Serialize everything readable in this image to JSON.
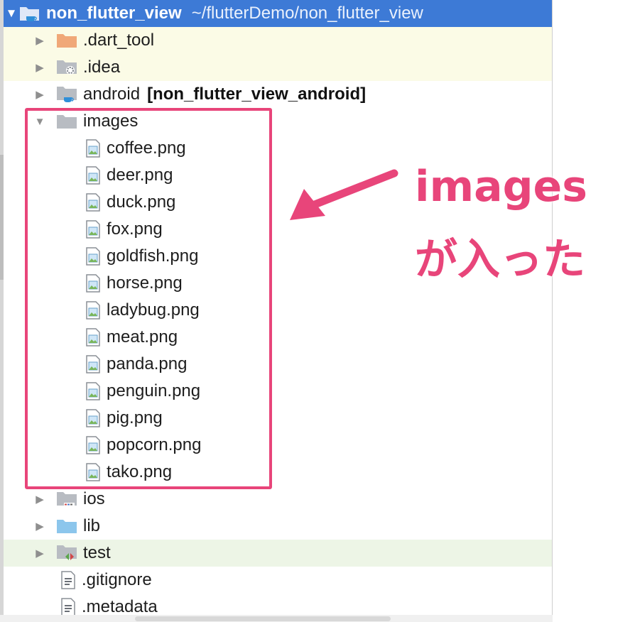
{
  "project": {
    "name": "non_flutter_view",
    "path": "~/flutterDemo/non_flutter_view",
    "expanded_arrow": "▼"
  },
  "tree": {
    "dart_tool": {
      "label": ".dart_tool",
      "arrow": "▶",
      "icon": "orange-folder-icon"
    },
    "idea": {
      "label": ".idea",
      "arrow": "▶",
      "icon": "settings-folder-icon"
    },
    "android": {
      "label": "android",
      "module": "[non_flutter_view_android]",
      "arrow": "▶",
      "icon": "module-folder-icon"
    },
    "images": {
      "label": "images",
      "arrow": "▼",
      "icon": "folder-icon",
      "files": [
        "coffee.png",
        "deer.png",
        "duck.png",
        "fox.png",
        "goldfish.png",
        "horse.png",
        "ladybug.png",
        "meat.png",
        "panda.png",
        "penguin.png",
        "pig.png",
        "popcorn.png",
        "tako.png"
      ]
    },
    "ios": {
      "label": "ios",
      "arrow": "▶",
      "icon": "ios-folder-icon"
    },
    "lib": {
      "label": "lib",
      "arrow": "▶",
      "icon": "source-folder-icon"
    },
    "test": {
      "label": "test",
      "arrow": "▶",
      "icon": "test-folder-icon"
    },
    "gitignore": {
      "label": ".gitignore",
      "icon": "text-file-icon"
    },
    "metadata": {
      "label": ".metadata",
      "icon": "text-file-icon"
    }
  },
  "annotation": {
    "line1": "images",
    "line2": "が入った",
    "color": "#e8457a"
  },
  "colors": {
    "header_bg": "#3d7ad6",
    "excluded_bg": "#fbfbe6",
    "test_bg": "#edf5e6"
  }
}
